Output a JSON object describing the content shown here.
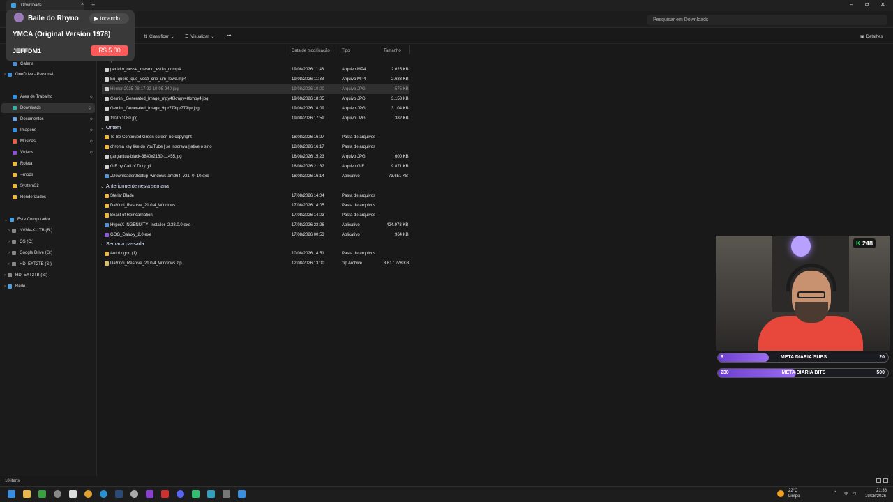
{
  "tab": {
    "title": "Downloads",
    "close": "×",
    "new": "+"
  },
  "window": {
    "minimize": "–",
    "restore": "⧉",
    "close": "✕"
  },
  "search": {
    "placeholder": "Pesquisar em Downloads"
  },
  "toolbar": {
    "sort": "Classificar",
    "view": "Visualizar",
    "more": "•••",
    "details": "Detalhes"
  },
  "columns": {
    "date": "Data de modificação",
    "type": "Tipo",
    "size": "Tamanho"
  },
  "sidebar": {
    "items": [
      {
        "label": "Galeria"
      },
      {
        "label": "OneDrive - Personal"
      },
      {
        "label": "Área de Trabalho"
      },
      {
        "label": "Downloads"
      },
      {
        "label": "Documentos"
      },
      {
        "label": "Imagens"
      },
      {
        "label": "Músicas"
      },
      {
        "label": "Vídeos"
      },
      {
        "label": "Roleta"
      },
      {
        "label": "--mods"
      },
      {
        "label": "System32"
      },
      {
        "label": "Renderizados"
      },
      {
        "label": "Este Computador"
      },
      {
        "label": "NVMe-K-1TB (B:)"
      },
      {
        "label": "OS (C:)"
      },
      {
        "label": "Google Drive (G:)"
      },
      {
        "label": "HD_EXT2TB (S:)"
      },
      {
        "label": "HD_EXT2TB (S:)"
      },
      {
        "label": "Rede"
      }
    ]
  },
  "groups": [
    {
      "label": "Hoje"
    },
    {
      "label": "Ontem"
    },
    {
      "label": "Anteriormente nesta semana"
    },
    {
      "label": "Semana passada"
    }
  ],
  "files": [
    {
      "name": "perfeito_nesse_mesmo_estilo_cr.mp4",
      "date": "19/08/2026 11:43",
      "type": "Arquivo MP4",
      "size": "2.625 KB"
    },
    {
      "name": "Eu_quero_que_você_crie_um_lowe.mp4",
      "date": "19/08/2026 11:38",
      "type": "Arquivo MP4",
      "size": "2.683 KB"
    },
    {
      "name": "Hemor 2025-08-17 22-10-05-940.jpg",
      "date": "19/08/2026 10:00",
      "type": "Arquivo JPG",
      "size": "575 KB"
    },
    {
      "name": "Gemini_Generated_Image_mpy48kmpy48kmpy4.jpg",
      "date": "19/08/2026 18:05",
      "type": "Arquivo JPG",
      "size": "3.153 KB"
    },
    {
      "name": "Gemini_Generated_Image_9tpr779tpr779tpr.jpg",
      "date": "19/08/2026 18:09",
      "type": "Arquivo JPG",
      "size": "3.104 KB"
    },
    {
      "name": "1920x1080.jpg",
      "date": "19/08/2026 17:59",
      "type": "Arquivo JPG",
      "size": "382 KB"
    },
    {
      "name": "To Be Continued Green screen no copyright",
      "date": "18/08/2026 16:27",
      "type": "Pasta de arquivos",
      "size": ""
    },
    {
      "name": "chroma key like do YouTube | se inscreva | ative o sino",
      "date": "18/08/2026 16:17",
      "type": "Pasta de arquivos",
      "size": ""
    },
    {
      "name": "gargantua-black-3840x2160-11455.jpg",
      "date": "18/08/2026 15:23",
      "type": "Arquivo JPG",
      "size": "600 KB"
    },
    {
      "name": "GIF by Call of Duty.gif",
      "date": "18/08/2026 21:32",
      "type": "Arquivo GIF",
      "size": "9.871 KB"
    },
    {
      "name": "JDownloader2Setup_windows-amd64_v21_0_10.exe",
      "date": "18/08/2026 16:14",
      "type": "Aplicativo",
      "size": "73.651 KB"
    },
    {
      "name": "Stellar Blade",
      "date": "17/08/2026 14:04",
      "type": "Pasta de arquivos",
      "size": ""
    },
    {
      "name": "DaVinci_Resolve_21.0.4_Windows",
      "date": "17/08/2026 14:05",
      "type": "Pasta de arquivos",
      "size": ""
    },
    {
      "name": "Beast of Reincarnation",
      "date": "17/08/2026 14:03",
      "type": "Pasta de arquivos",
      "size": ""
    },
    {
      "name": "HyperX_NGENUITY_Installer_2.38.0.0.exe",
      "date": "17/08/2026 23:26",
      "type": "Aplicativo",
      "size": "424.978 KB"
    },
    {
      "name": "GOG_Galaxy_2.0.exe",
      "date": "17/08/2026 00:53",
      "type": "Aplicativo",
      "size": "964 KB"
    },
    {
      "name": "AutoLogon (1)",
      "date": "10/08/2026 14:51",
      "type": "Pasta de arquivos",
      "size": ""
    },
    {
      "name": "DaVinci_Resolve_21.0.4_Windows.zip",
      "date": "12/08/2026 13:00",
      "type": "zip Archive",
      "size": "3.617.278 KB"
    }
  ],
  "status": {
    "count": "18 itens"
  },
  "overlay": {
    "channel": "Baile do Rhyno",
    "playing": "▶ tocando",
    "song": "YMCA (Original Version 1978)",
    "user": "JEFFDM1",
    "price": "R$ 5.00"
  },
  "stream": {
    "viewers": "248",
    "goals": [
      {
        "current": "6",
        "label": "META DIARIA SUBS",
        "max": "20",
        "progress": 0.3
      },
      {
        "current": "230",
        "label": "META DIARIA BITS",
        "max": "500",
        "progress": 0.46
      }
    ]
  },
  "tray": {
    "weather_temp": "22°C",
    "weather_text": "Limpo",
    "time": "21:36",
    "date": "19/08/2026"
  },
  "colors": {
    "accent": "#3aa0e8",
    "folder": "#e8b84a",
    "goal": "#8a5cf0"
  }
}
